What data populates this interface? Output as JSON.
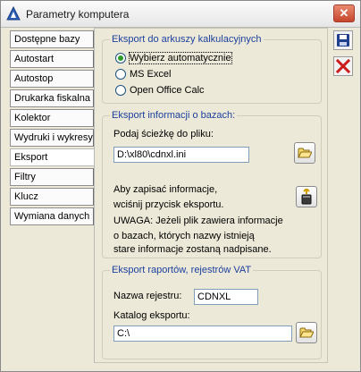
{
  "window": {
    "title": "Parametry komputera",
    "close_label": "✕"
  },
  "tabs": [
    {
      "label": "Dostępne bazy"
    },
    {
      "label": "Autostart"
    },
    {
      "label": "Autostop"
    },
    {
      "label": "Drukarka fiskalna"
    },
    {
      "label": "Kolektor"
    },
    {
      "label": "Wydruki i wykresy"
    },
    {
      "label": "Eksport"
    },
    {
      "label": "Filtry"
    },
    {
      "label": "Klucz"
    },
    {
      "label": "Wymiana danych"
    }
  ],
  "active_tab": "Eksport",
  "spreadsheet_export": {
    "title": "Eksport do arkuszy kalkulacyjnych",
    "options": [
      {
        "label": "Wybierz automatycznie",
        "selected": true
      },
      {
        "label": "MS Excel",
        "selected": false
      },
      {
        "label": "Open Office Calc",
        "selected": false
      }
    ]
  },
  "db_info_export": {
    "title": "Eksport informacji o bazach:",
    "path_label": "Podaj ścieżkę do pliku:",
    "path_value": "D:\\xl80\\cdnxl.ini",
    "info_line1": "Aby zapisać informacje,",
    "info_line2": "wciśnij przycisk eksportu.",
    "warning_line1": "UWAGA: Jeżeli plik zawiera informacje",
    "warning_line2": "o bazach, których nazwy istnieją",
    "warning_line3": "stare informacje zostaną nadpisane."
  },
  "reports_export": {
    "title": "Eksport raportów, rejestrów VAT",
    "register_label": "Nazwa rejestru:",
    "register_value": "CDNXL",
    "catalog_label": "Katalog eksportu:",
    "catalog_value": "C:\\"
  },
  "colors": {
    "group_title": "#1c3f9e",
    "save_icon": "#1f3f8f",
    "cancel_icon": "#cc1b1b"
  }
}
